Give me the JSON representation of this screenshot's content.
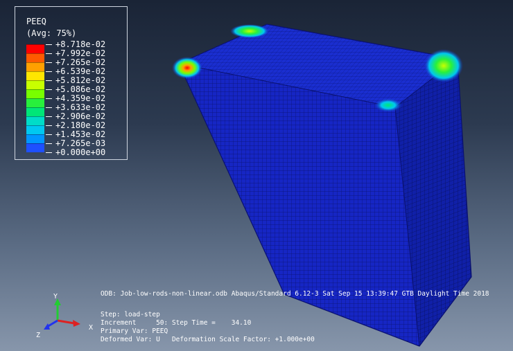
{
  "legend": {
    "title": "PEEQ",
    "subtitle": "(Avg: 75%)",
    "entries": [
      {
        "label": "+8.718e-02",
        "color": "#ff0000"
      },
      {
        "label": "+7.992e-02",
        "color": "#ff5a00"
      },
      {
        "label": "+7.265e-02",
        "color": "#ffa000"
      },
      {
        "label": "+6.539e-02",
        "color": "#ffe600"
      },
      {
        "label": "+5.812e-02",
        "color": "#c8ff00"
      },
      {
        "label": "+5.086e-02",
        "color": "#78ff00"
      },
      {
        "label": "+4.359e-02",
        "color": "#28f03c"
      },
      {
        "label": "+3.633e-02",
        "color": "#00e678"
      },
      {
        "label": "+2.906e-02",
        "color": "#00dcc8"
      },
      {
        "label": "+2.180e-02",
        "color": "#00c8f0"
      },
      {
        "label": "+1.453e-02",
        "color": "#0096ff"
      },
      {
        "label": "+7.265e-03",
        "color": "#1e50ff"
      },
      {
        "label": "+0.000e+00",
        "color": "#0a1ee6"
      }
    ]
  },
  "info": {
    "odb_line": "ODB: Job-low-rods-non-linear.odb    Abaqus/Standard 6.12-3    Sat Sep 15 13:39:47 GTB Daylight Time 2018",
    "step": "Step: load-step",
    "increment": "Increment     50: Step Time =    34.10",
    "primary_var": "Primary Var: PEEQ",
    "deformed_var": "Deformed Var: U   Deformation Scale Factor: +1.000e+00"
  },
  "triad": {
    "x": "X",
    "y": "Y",
    "z": "Z"
  },
  "colors": {
    "mesh_blue": "#1420b8",
    "mesh_face_front": "#1626c4",
    "mesh_face_right": "#0f1a9c",
    "mesh_top": "#1a2ed0"
  }
}
